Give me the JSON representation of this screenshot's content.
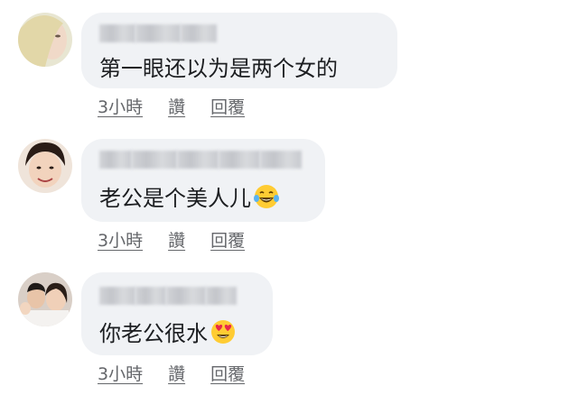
{
  "comments": [
    {
      "text": "第一眼还以为是两个女的",
      "actions": {
        "time": "3小時",
        "like": "讚",
        "reply": "回覆"
      }
    },
    {
      "text": "老公是个美人儿",
      "emoji": "tears-of-joy-emoji",
      "actions": {
        "time": "3小時",
        "like": "讚",
        "reply": "回覆"
      }
    },
    {
      "text": "你老公很水",
      "emoji": "heart-eyes-emoji",
      "actions": {
        "time": "3小時",
        "like": "讚",
        "reply": "回覆"
      }
    }
  ],
  "colors": {
    "bubble": "#f0f2f5",
    "text": "#1c1e21",
    "actions": "#65676b",
    "emoji": "#ffcc33"
  }
}
